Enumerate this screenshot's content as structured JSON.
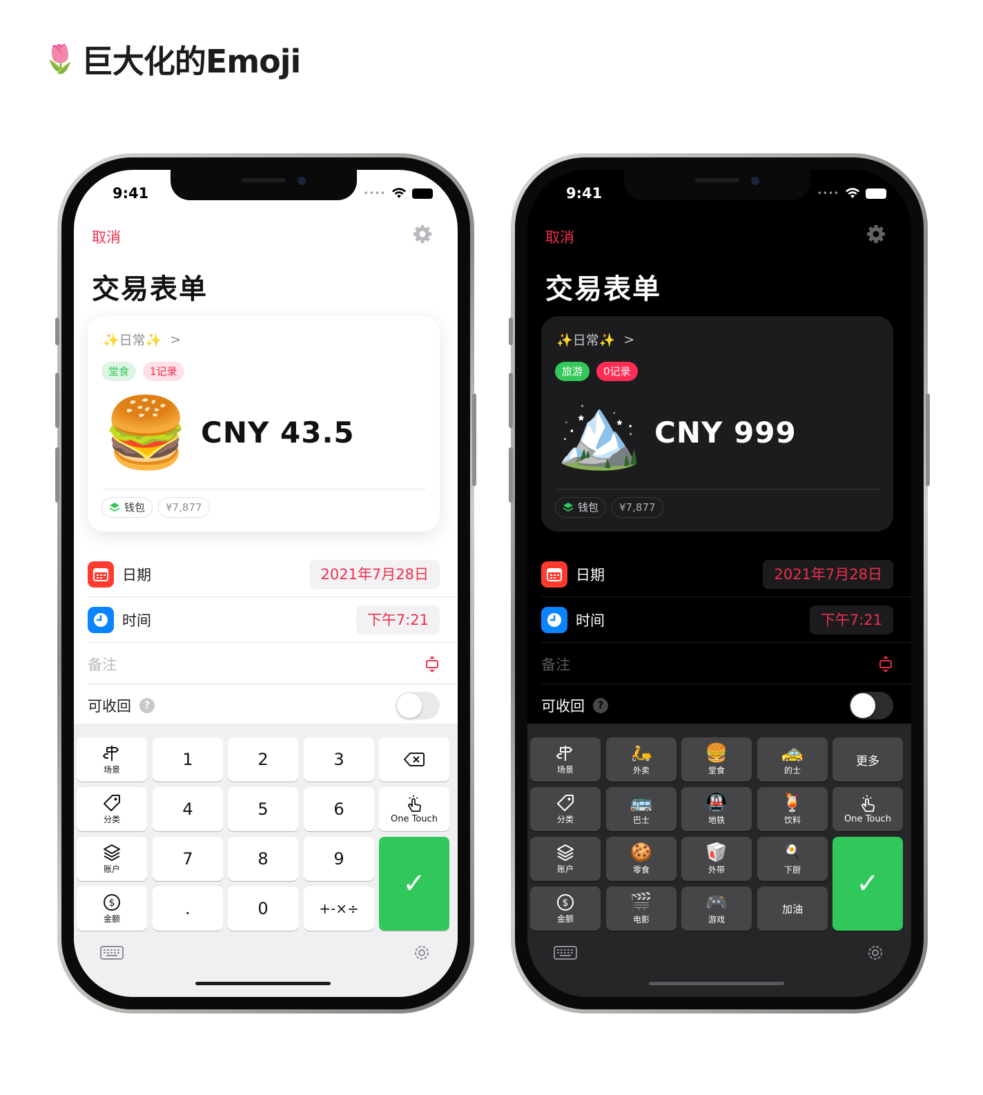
{
  "page_title": {
    "emoji": "🌷",
    "text": "巨大化的Emoji"
  },
  "phones": {
    "light": {
      "status_time": "9:41",
      "cancel": "取消",
      "form_title": "交易表单",
      "card": {
        "tag": "✨日常✨",
        "chevron": ">",
        "chip1": "堂食",
        "chip2": "1记录",
        "hero_emoji": "🍔",
        "amount": "CNY 43.5",
        "wallet_label": "钱包",
        "balance": "¥7,877"
      },
      "date_label": "日期",
      "date_value": "2021年7月28日",
      "time_label": "时间",
      "time_value": "下午7:21",
      "note_placeholder": "备注",
      "refund_label": "可收回",
      "help": "?",
      "keys": {
        "scene": "场景",
        "k1": "1",
        "k2": "2",
        "k3": "3",
        "category": "分类",
        "k4": "4",
        "k5": "5",
        "k6": "6",
        "one_touch": "One Touch",
        "account": "账户",
        "k7": "7",
        "k8": "8",
        "k9": "9",
        "amount_key": "金额",
        "dot": ".",
        "k0": "0",
        "ops": "+-×÷",
        "confirm": "✓"
      }
    },
    "dark": {
      "status_time": "9:41",
      "cancel": "取消",
      "form_title": "交易表单",
      "card": {
        "tag": "✨日常✨",
        "chevron": ">",
        "chip1": "旅游",
        "chip2": "0记录",
        "hero_emoji": "🏔️",
        "amount": "CNY 999",
        "wallet_label": "钱包",
        "balance": "¥7,877"
      },
      "date_label": "日期",
      "date_value": "2021年7月28日",
      "time_label": "时间",
      "time_value": "下午7:21",
      "note_placeholder": "备注",
      "refund_label": "可收回",
      "help": "?",
      "keys": {
        "scene": "场景",
        "takeout": {
          "emoji": "🛵",
          "label": "外卖"
        },
        "dinein": {
          "emoji": "🍔",
          "label": "堂食"
        },
        "taxi": {
          "emoji": "🚕",
          "label": "的士"
        },
        "more": "更多",
        "category": "分类",
        "bus": {
          "emoji": "🚌",
          "label": "巴士"
        },
        "subway": {
          "emoji": "🚇",
          "label": "地铁"
        },
        "drink": {
          "emoji": "🍹",
          "label": "饮料"
        },
        "one_touch": "One Touch",
        "account": "账户",
        "snack": {
          "emoji": "🍪",
          "label": "零食"
        },
        "takeaway": {
          "emoji": "🥡",
          "label": "外带"
        },
        "cook": {
          "emoji": "🍳",
          "label": "下厨"
        },
        "amount_key": "金额",
        "movie": {
          "emoji": "🎬",
          "label": "电影"
        },
        "game": {
          "emoji": "🎮",
          "label": "游戏"
        },
        "fuel": "加油",
        "confirm": "✓"
      }
    }
  },
  "colors": {
    "accent_red": "#ef2f4c",
    "confirm_green": "#30c85a",
    "chip_green_bg": "#dff4e4",
    "chip_green_text": "#34c759",
    "chip_pink_bg": "#fde1e6",
    "chip_pink_text": "#ef2f4c"
  }
}
